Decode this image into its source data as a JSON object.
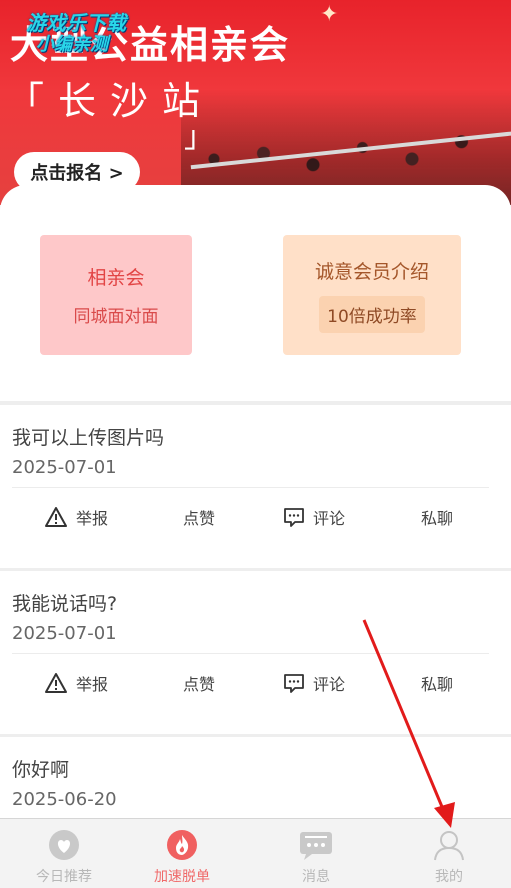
{
  "banner": {
    "title": "大型公益相亲会",
    "watermark_line1": "游戏乐下载",
    "watermark_line2": "小编亲测",
    "slogan": "「长沙站",
    "slogan_close": "」",
    "signup_label": "点击报名 >"
  },
  "tiles": [
    {
      "title": "相亲会",
      "subtitle": "同城面对面"
    },
    {
      "title": "诚意会员介绍",
      "subtitle": "10倍成功率"
    }
  ],
  "posts": [
    {
      "title": "我可以上传图片吗",
      "date": "2025-07-01"
    },
    {
      "title": "我能说话吗?",
      "date": "2025-07-01"
    },
    {
      "title": "你好啊",
      "date": "2025-06-20"
    }
  ],
  "actions": {
    "report": "举报",
    "like": "点赞",
    "comment": "评论",
    "chat": "私聊"
  },
  "nav": {
    "items": [
      {
        "label": "今日推荐",
        "icon": "heart-icon"
      },
      {
        "label": "加速脱单",
        "icon": "flame-icon"
      },
      {
        "label": "消息",
        "icon": "message-icon"
      },
      {
        "label": "我的",
        "icon": "user-icon"
      }
    ],
    "active_color": "#f06a6a"
  },
  "colors": {
    "banner_red": "#e8232b",
    "tile_pink": "#fec8c9",
    "tile_peach": "#ffe0c8",
    "annotation_arrow": "#e21b1b"
  }
}
